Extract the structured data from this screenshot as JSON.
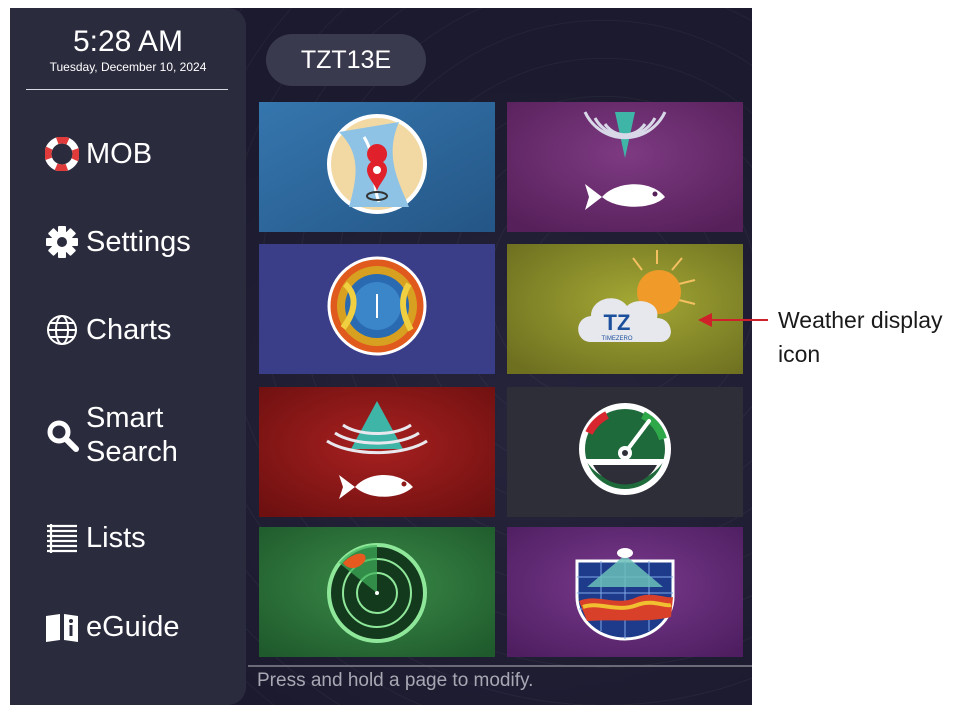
{
  "clock": {
    "time": "5:28 AM",
    "date": "Tuesday, December 10, 2024"
  },
  "sidebar": {
    "items": [
      {
        "label": "MOB",
        "icon": "lifebuoy-icon"
      },
      {
        "label": "Settings",
        "icon": "gear-icon"
      },
      {
        "label": "Charts",
        "icon": "globe-icon"
      },
      {
        "label_line1": "Smart",
        "label_line2": "Search",
        "icon": "search-icon"
      },
      {
        "label": "Lists",
        "icon": "list-icon"
      },
      {
        "label": "eGuide",
        "icon": "book-info-icon"
      }
    ]
  },
  "model": {
    "label": "TZT13E"
  },
  "tiles": [
    {
      "icon": "chart-plotter-icon",
      "color": "#2e6a9e"
    },
    {
      "icon": "fish-sonar-icon",
      "color": "#6a2a6e"
    },
    {
      "icon": "radar-overlay-icon",
      "color": "#3a3d86"
    },
    {
      "icon": "weather-icon",
      "color": "#8a8a24",
      "logo_text": "TZ",
      "logo_sub": "TIMEZERO"
    },
    {
      "icon": "fish-finder-icon",
      "color": "#8c1818"
    },
    {
      "icon": "gauge-icon",
      "color": "#2e2e38"
    },
    {
      "icon": "radar-icon",
      "color": "#2c6a3a"
    },
    {
      "icon": "3d-sonar-icon",
      "color": "#6a2e7a"
    }
  ],
  "footer": {
    "hint": "Press and hold a page to modify."
  },
  "callout": {
    "line1": "Weather display",
    "line2": "icon",
    "arrow_color": "#d0202a"
  }
}
